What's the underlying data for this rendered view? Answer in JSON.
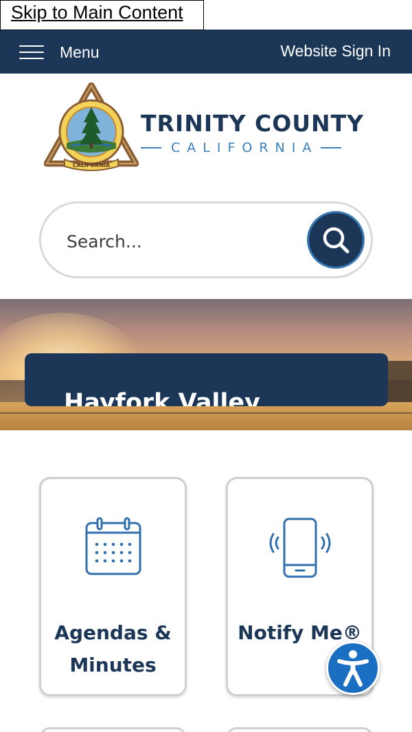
{
  "skip_link": {
    "label": "Skip to Main Content"
  },
  "topbar": {
    "menu_label": "Menu",
    "signin_label": "Website Sign In",
    "color": "#1b3657"
  },
  "logo": {
    "title": "TRINITY COUNTY",
    "subtitle": "CALIFORNIA",
    "seal_text": "CALIFORNIA"
  },
  "search": {
    "placeholder": "Search..."
  },
  "hero": {
    "caption": "Hayfork Valley"
  },
  "tiles": [
    {
      "label_line1": "Agendas &",
      "label_line2": "Minutes",
      "icon": "calendar-icon"
    },
    {
      "label_line1": "Notify Me®",
      "label_line2": "",
      "icon": "mobile-phone-icon"
    }
  ],
  "accessibility": {
    "icon": "accessibility-icon",
    "color": "#1a6fc2"
  },
  "colors": {
    "brand_navy": "#1b3657",
    "accent_blue": "#3a7fb8"
  }
}
